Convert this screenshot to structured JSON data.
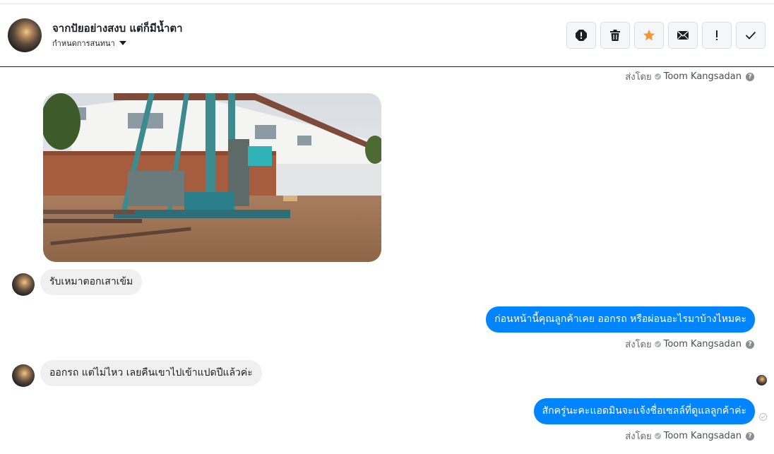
{
  "header": {
    "title": "จากปัยอย่างสงบ แต่ก็มีน้ำตา",
    "subtitle": "กำหนดการสนทนา",
    "toolbar": [
      {
        "name": "report-button",
        "icon": "exclamation-circle-icon"
      },
      {
        "name": "delete-button",
        "icon": "trash-icon"
      },
      {
        "name": "star-button",
        "icon": "star-icon",
        "color": "#f7923b"
      },
      {
        "name": "mark-unread-button",
        "icon": "envelope-icon"
      },
      {
        "name": "important-button",
        "icon": "exclamation-icon",
        "label": "!"
      },
      {
        "name": "done-button",
        "icon": "check-icon"
      }
    ]
  },
  "sent_by_prefix": "ส่งโดย",
  "sent_by_name": "Toom Kangsadan",
  "messages": [
    {
      "from": "customer",
      "type": "image",
      "description": "photo-attachment"
    },
    {
      "from": "customer",
      "text": "รับเหมาตอกเสาเข้ม"
    },
    {
      "from": "page",
      "text": "ก่อนหน้านี้คุณลูกค้าเคย ออกรถ หรือผ่อนอะไรมาบ้างไหมคะ"
    },
    {
      "from": "customer",
      "text": "ออกรถ แต่ไม่ไหว เลยคืนเขาไปเข้าแปดปีแล้วค่ะ"
    },
    {
      "from": "page",
      "text": "สักครู่นะคะแอดมินจะแจ้งชื่อเซลล์ที่ดูแลลูกค้าค่ะ"
    }
  ],
  "colors": {
    "outgoing_bubble": "#0084ff",
    "incoming_bubble": "#f0f0f0",
    "star": "#f7923b"
  }
}
